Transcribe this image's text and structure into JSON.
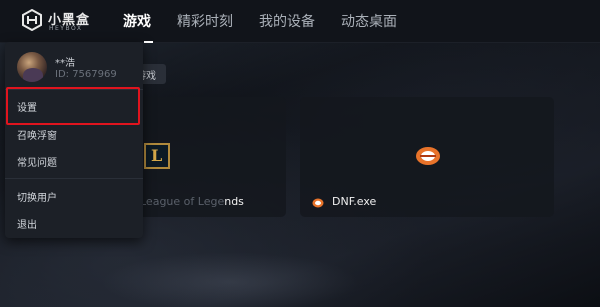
{
  "app": {
    "logo_name": "小黑盒",
    "logo_sub": "HEYBOX"
  },
  "nav": {
    "tabs": [
      {
        "label": "游戏",
        "active": true
      },
      {
        "label": "精彩时刻",
        "active": false
      },
      {
        "label": "我的设备",
        "active": false
      },
      {
        "label": "动态桌面",
        "active": false
      }
    ]
  },
  "section": {
    "chip_label": "游戏"
  },
  "games": [
    {
      "name_dim": "League of Lege",
      "name_visible": "nds",
      "icon": "league-of-legends-icon"
    },
    {
      "name": "DNF.exe",
      "icon": "dnf-icon"
    }
  ],
  "user_menu": {
    "user_name": "**浩",
    "user_id": "ID: 7567969",
    "items": [
      {
        "label": "设置",
        "highlighted": true
      },
      {
        "label": "召唤浮窗"
      },
      {
        "label": "常见问题"
      },
      {
        "label": "切换用户"
      },
      {
        "label": "退出"
      }
    ]
  },
  "colors": {
    "highlight_border": "#e0141e",
    "lol_gold": "#d6a94a",
    "dnf_orange": "#e8732a"
  }
}
